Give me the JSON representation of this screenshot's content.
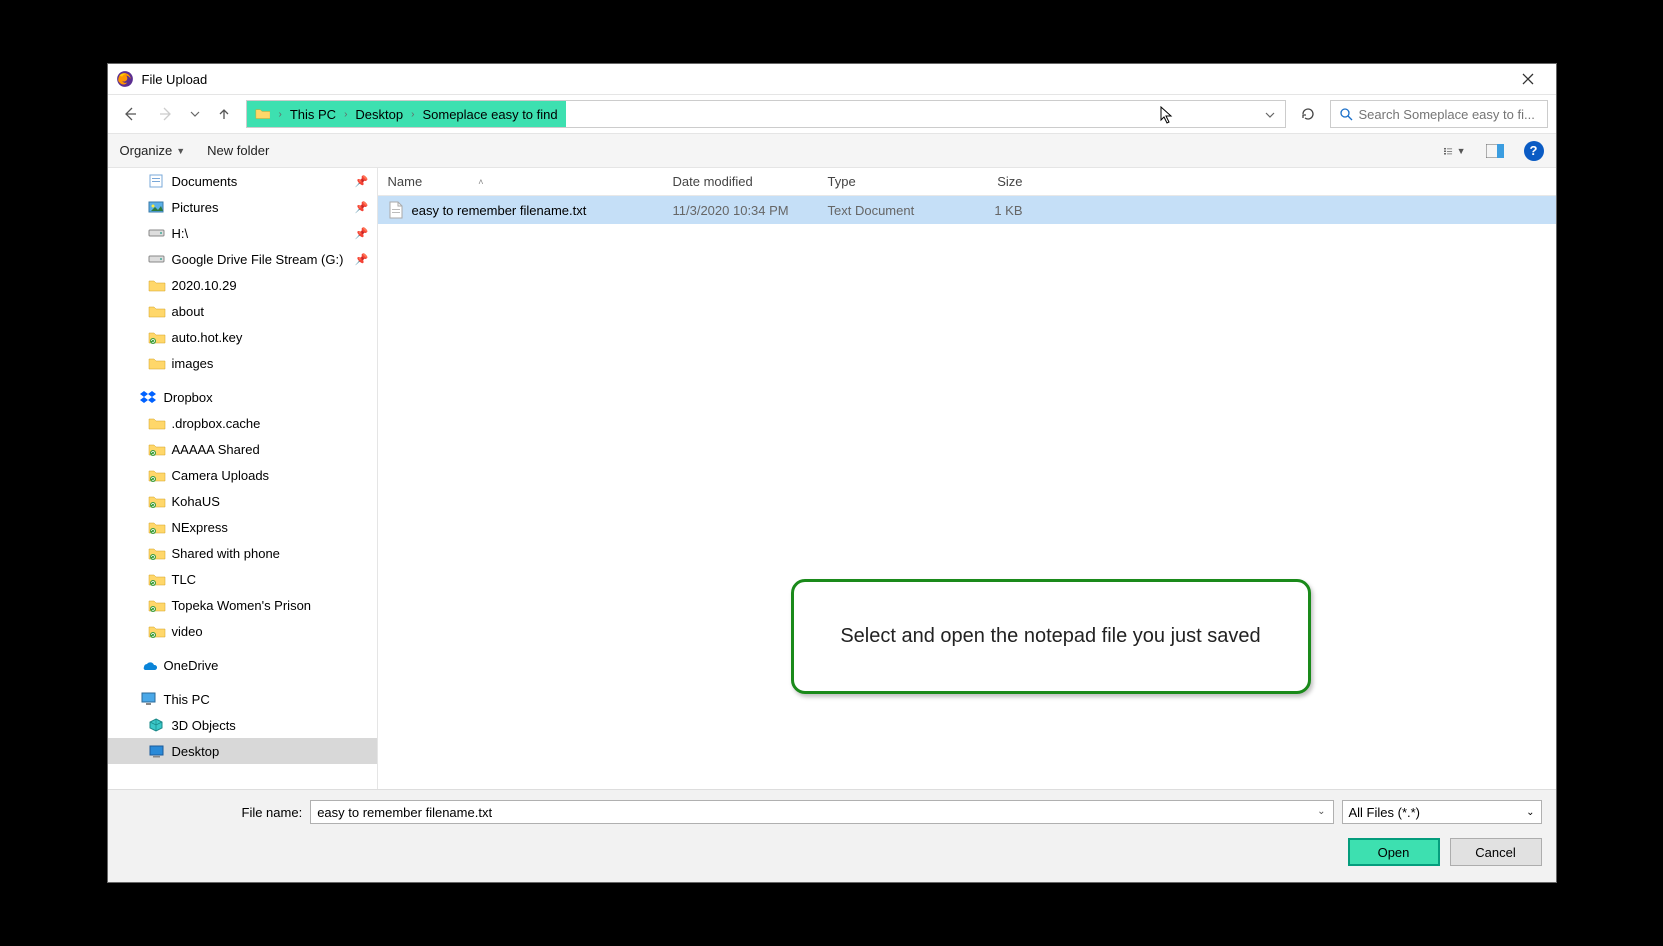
{
  "window": {
    "title": "File Upload"
  },
  "breadcrumb": {
    "parts": [
      "This PC",
      "Desktop",
      "Someplace easy to find"
    ]
  },
  "search": {
    "placeholder": "Search Someplace easy to fi..."
  },
  "toolbar": {
    "organize": "Organize",
    "newfolder": "New folder"
  },
  "columns": {
    "name": "Name",
    "date": "Date modified",
    "type": "Type",
    "size": "Size"
  },
  "files": [
    {
      "name": "easy to remember filename.txt",
      "date": "11/3/2020 10:34 PM",
      "type": "Text Document",
      "size": "1 KB"
    }
  ],
  "sidebar": [
    {
      "label": "Documents",
      "icon": "docs",
      "pin": true,
      "pad": "pad1"
    },
    {
      "label": "Pictures",
      "icon": "pics",
      "pin": true,
      "pad": "pad1"
    },
    {
      "label": "H:\\",
      "icon": "drive",
      "pin": true,
      "pad": "pad1"
    },
    {
      "label": "Google Drive File Stream (G:)",
      "icon": "drive",
      "pin": true,
      "pad": "pad1"
    },
    {
      "label": "2020.10.29",
      "icon": "folder",
      "pad": "pad1"
    },
    {
      "label": "about",
      "icon": "folder",
      "pad": "pad1"
    },
    {
      "label": "auto.hot.key",
      "icon": "syncfolder",
      "pad": "pad1"
    },
    {
      "label": "images",
      "icon": "folder",
      "pad": "pad1"
    },
    {
      "label": "Dropbox",
      "icon": "dropbox",
      "pad": "pad0",
      "gap": true
    },
    {
      "label": ".dropbox.cache",
      "icon": "folder",
      "pad": "pad1"
    },
    {
      "label": "AAAAA Shared",
      "icon": "syncfolder",
      "pad": "pad1"
    },
    {
      "label": "Camera Uploads",
      "icon": "syncfolder",
      "pad": "pad1"
    },
    {
      "label": "KohaUS",
      "icon": "syncfolder",
      "pad": "pad1"
    },
    {
      "label": "NExpress",
      "icon": "syncfolder",
      "pad": "pad1"
    },
    {
      "label": "Shared with phone",
      "icon": "syncfolder",
      "pad": "pad1"
    },
    {
      "label": "TLC",
      "icon": "syncfolder",
      "pad": "pad1"
    },
    {
      "label": "Topeka Women's Prison",
      "icon": "syncfolder",
      "pad": "pad1"
    },
    {
      "label": "video",
      "icon": "syncfolder",
      "pad": "pad1"
    },
    {
      "label": "OneDrive",
      "icon": "onedrive",
      "pad": "pad0",
      "gap": true
    },
    {
      "label": "This PC",
      "icon": "thispc",
      "pad": "pad0",
      "gap": true
    },
    {
      "label": "3D Objects",
      "icon": "3d",
      "pad": "pad1"
    },
    {
      "label": "Desktop",
      "icon": "desktop",
      "pad": "pad1",
      "selected": true
    }
  ],
  "footer": {
    "label": "File name:",
    "filename": "easy to remember filename.txt",
    "filter": "All Files (*.*)",
    "open": "Open",
    "cancel": "Cancel"
  },
  "callout": "Select and open the notepad file you just saved"
}
